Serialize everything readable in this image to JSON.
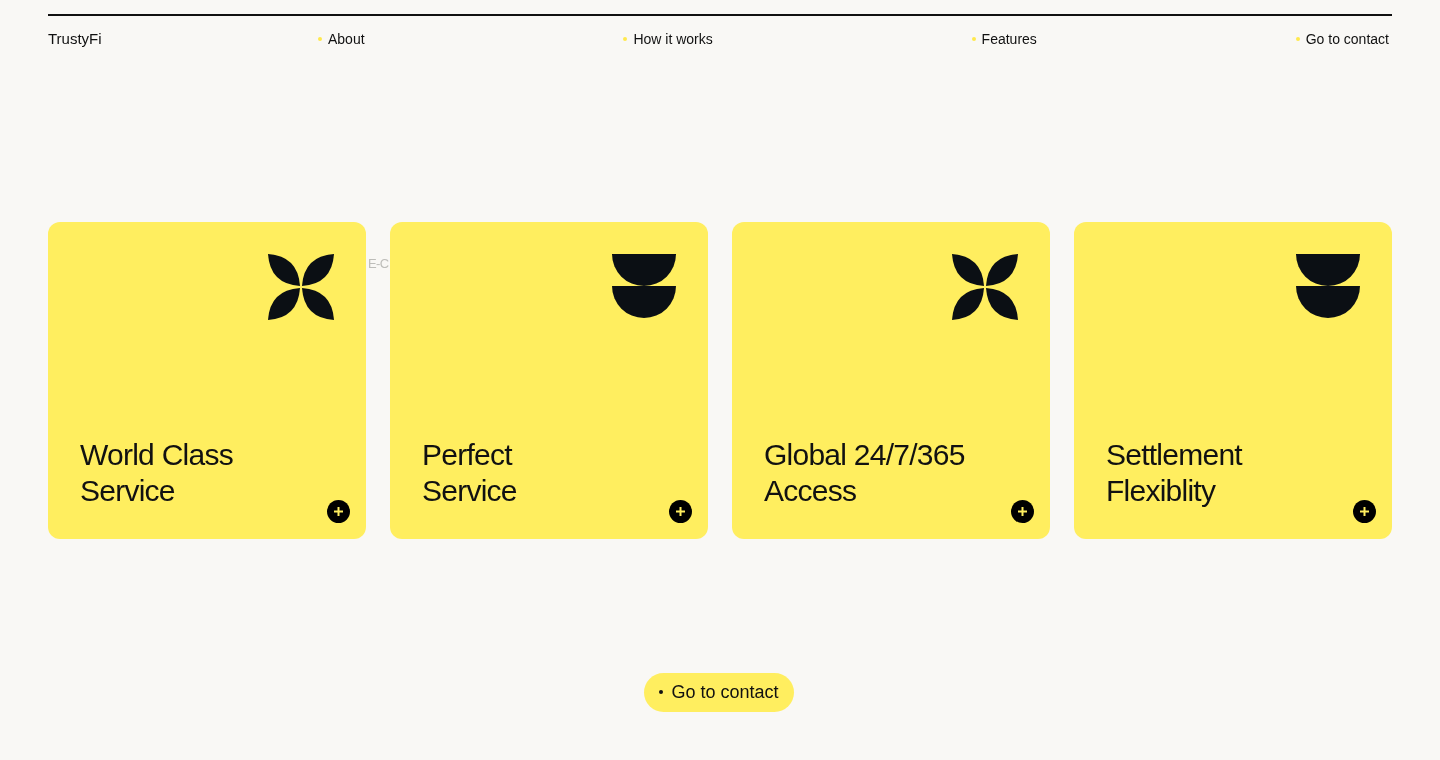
{
  "header": {
    "logo": "TrustyFi",
    "nav": [
      "About",
      "How it works",
      "Features",
      "Go to contact"
    ]
  },
  "background_text": "E-C",
  "cards": [
    {
      "title": "World Class\nService",
      "kind": "petals"
    },
    {
      "title": "Perfect\nService",
      "kind": "half-circles"
    },
    {
      "title": "Global 24/7/365\nAccess",
      "kind": "petals"
    },
    {
      "title": "Settlement\nFlexiblity",
      "kind": "half-circles"
    }
  ],
  "cta": "Go to contact"
}
